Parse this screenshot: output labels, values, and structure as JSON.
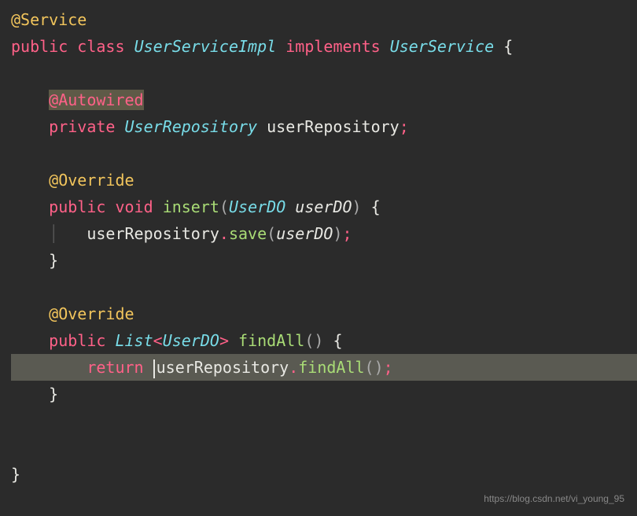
{
  "code": {
    "line1_annotation": "@Service",
    "line2_kw1": "public",
    "line2_kw2": "class",
    "line2_type": "UserServiceImpl",
    "line2_kw3": "implements",
    "line2_type2": "UserService",
    "line2_brace": "{",
    "line4_annotation": "@Autowired",
    "line5_kw": "private",
    "line5_type": "UserRepository",
    "line5_id": "userRepository",
    "line5_semi": ";",
    "line7_annotation": "@Override",
    "line8_kw1": "public",
    "line8_kw2": "void",
    "line8_method": "insert",
    "line8_paren1": "(",
    "line8_ptype": "UserDO",
    "line8_pname": "userDO",
    "line8_paren2": ")",
    "line8_brace": "{",
    "line9_obj": "userRepository",
    "line9_dot": ".",
    "line9_method": "save",
    "line9_paren1": "(",
    "line9_arg": "userDO",
    "line9_paren2": ")",
    "line9_semi": ";",
    "line10_brace": "}",
    "line12_annotation": "@Override",
    "line13_kw": "public",
    "line13_type": "List",
    "line13_lt": "<",
    "line13_gtype": "UserDO",
    "line13_gt": ">",
    "line13_method": "findAll",
    "line13_parens": "()",
    "line13_brace": "{",
    "line14_kw": "return",
    "line14_obj": "userRepository",
    "line14_dot": ".",
    "line14_method": "findAll",
    "line14_parens": "()",
    "line14_semi": ";",
    "line15_brace": "}",
    "line18_brace": "}"
  },
  "watermark": "https://blog.csdn.net/vi_young_95"
}
